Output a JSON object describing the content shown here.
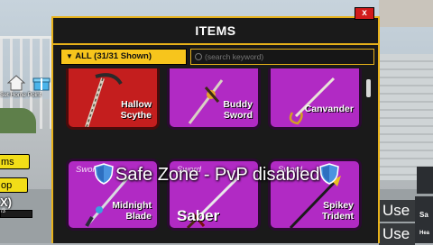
{
  "window": {
    "title": "ITEMS",
    "close_label": "x",
    "filter_label": "ALL (31/31 Shown)",
    "search_placeholder": "(search keyword)"
  },
  "items": [
    {
      "type": "",
      "name": [
        "Hallow",
        "Scythe"
      ],
      "rarity_color": "#c41e1e"
    },
    {
      "type": "",
      "name": [
        "Buddy",
        "Sword"
      ],
      "rarity_color": "#b12ac4"
    },
    {
      "type": "",
      "name": [
        "Canvander"
      ],
      "rarity_color": "#b12ac4"
    },
    {
      "type": "Sword",
      "name": [
        "Midnight",
        "Blade"
      ],
      "rarity_color": "#b12ac4"
    },
    {
      "type": "Sword",
      "name": [
        "Saber"
      ],
      "rarity_color": "#b12ac4"
    },
    {
      "type": "Sword",
      "name": [
        "Spikey",
        "Trident"
      ],
      "rarity_color": "#b12ac4"
    }
  ],
  "overlay": {
    "banner": "Safe Zone - PvP disabled"
  },
  "hud_left": {
    "home_label": "Set Home Point",
    "btn1": "ms",
    "btn2": "op",
    "x_text": "X)",
    "bar_text": "/3"
  },
  "hud_right": {
    "use1": "Use",
    "use2": "Use",
    "sa": "Sa",
    "he": "Hea"
  },
  "colors": {
    "accent": "#e8b21a",
    "legendary": "#b12ac4",
    "mythic": "#c41e1e"
  }
}
